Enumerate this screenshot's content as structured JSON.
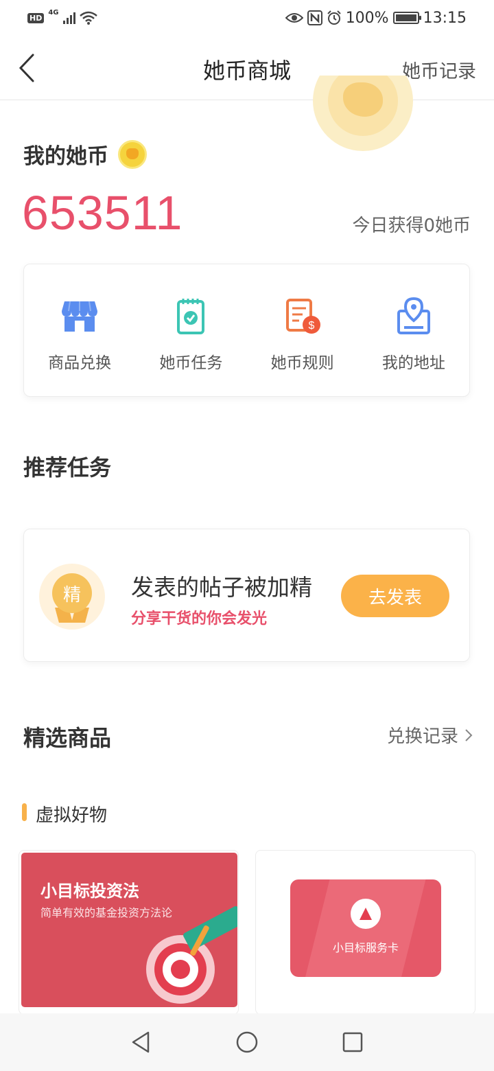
{
  "status_bar": {
    "hd": "HD",
    "network": "4G",
    "battery": "100%",
    "battery_level": 1.0,
    "time": "13:15",
    "icons": [
      "eye-icon",
      "nfc-icon",
      "alarm-icon",
      "battery-icon",
      "wifi-icon",
      "signal-icon"
    ]
  },
  "nav": {
    "title": "她币商城",
    "right_link": "她币记录"
  },
  "coins": {
    "label": "我的她币",
    "value": "653511",
    "today": "今日获得0她币"
  },
  "menu": [
    {
      "label": "商品兑换",
      "icon": "store-icon"
    },
    {
      "label": "她币任务",
      "icon": "clipboard-check-icon"
    },
    {
      "label": "她币规则",
      "icon": "document-dollar-icon"
    },
    {
      "label": "我的地址",
      "icon": "location-pin-icon"
    }
  ],
  "recommended": {
    "title": "推荐任务",
    "task": {
      "badge": "精",
      "title": "发表的帖子被加精",
      "subtitle": "分享干货的你会发光",
      "button": "去发表"
    }
  },
  "featured": {
    "title": "精选商品",
    "record_link": "兑换记录",
    "category": "虚拟好物",
    "products": [
      {
        "title": "小目标投资法",
        "subtitle": "简单有效的基金投资方法论"
      },
      {
        "card_name": "小目标服务卡"
      }
    ]
  },
  "colors": {
    "accent": "#e8506b",
    "button": "#fbb249",
    "product_red": "#d94f5c"
  }
}
